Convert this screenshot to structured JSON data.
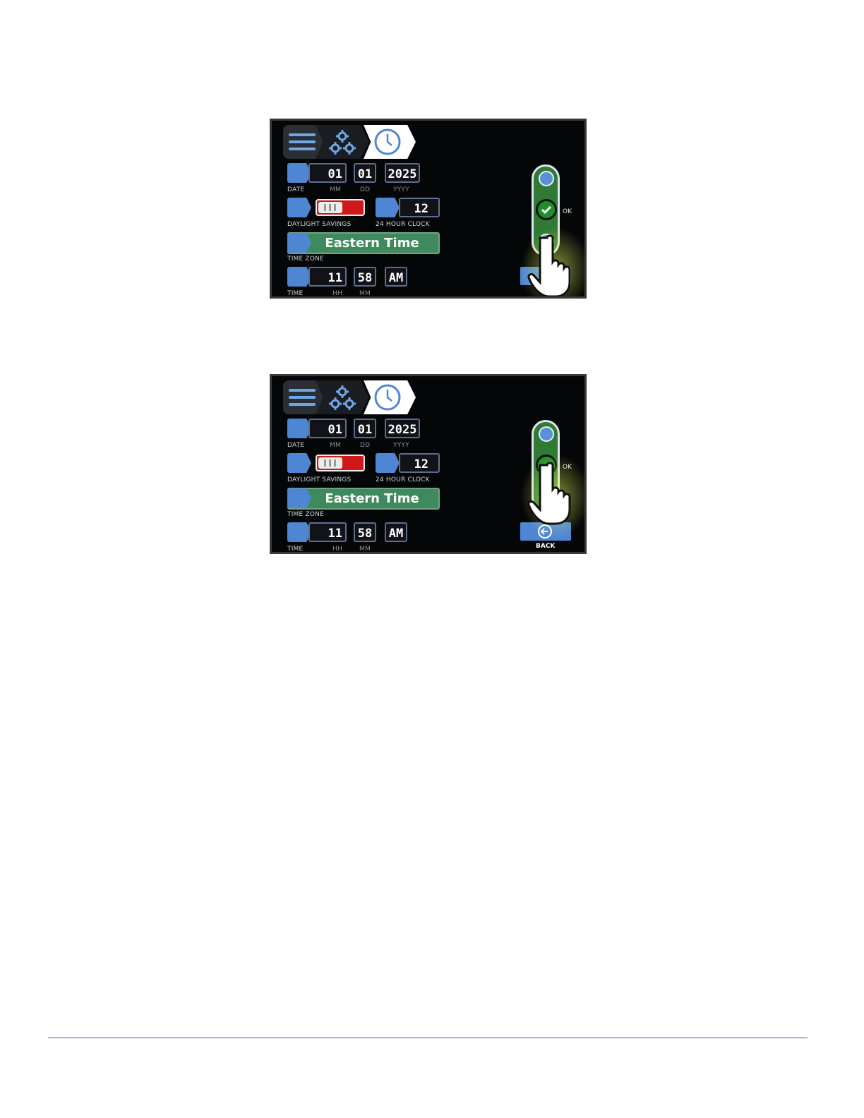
{
  "screens": [
    {
      "date": {
        "label": "DATE",
        "mm": "01",
        "mm_label": "MM",
        "dd": "01",
        "dd_label": "DD",
        "yyyy": "2025",
        "yyyy_label": "YYYY"
      },
      "dst": {
        "label": "DAYLIGHT SAVINGS"
      },
      "clock24": {
        "label": "24 HOUR CLOCK",
        "value": "12"
      },
      "timezone": {
        "label": "TIME ZONE",
        "value": "Eastern Time"
      },
      "time": {
        "label": "TIME",
        "hh": "11",
        "hh_label": "HH",
        "mm": "58",
        "mm_label": "MM",
        "ampm": "AM"
      },
      "ok_label": "OK",
      "back_label": ""
    },
    {
      "date": {
        "label": "DATE",
        "mm": "01",
        "mm_label": "MM",
        "dd": "01",
        "dd_label": "DD",
        "yyyy": "2025",
        "yyyy_label": "YYYY"
      },
      "dst": {
        "label": "DAYLIGHT SAVINGS"
      },
      "clock24": {
        "label": "24 HOUR CLOCK",
        "value": "12"
      },
      "timezone": {
        "label": "TIME ZONE",
        "value": "Eastern Time"
      },
      "time": {
        "label": "TIME",
        "hh": "11",
        "hh_label": "HH",
        "mm": "58",
        "mm_label": "MM",
        "ampm": "AM"
      },
      "ok_label": "OK",
      "back_label": "BACK"
    }
  ],
  "colors": {
    "accent": "#4f86d3",
    "timezone_bg": "#3f8a5d",
    "toggle_off": "#d01818",
    "pill": "#2f7a35"
  },
  "icons": [
    "menu-icon",
    "gears-icon",
    "clock-icon",
    "calendar-icon",
    "dst-clock-icon",
    "24-hour-icon",
    "globe-clock-icon",
    "time-clock-icon",
    "chevron-up-icon",
    "check-icon",
    "chevron-down-icon",
    "back-arrow-icon",
    "pointing-hand-icon"
  ]
}
